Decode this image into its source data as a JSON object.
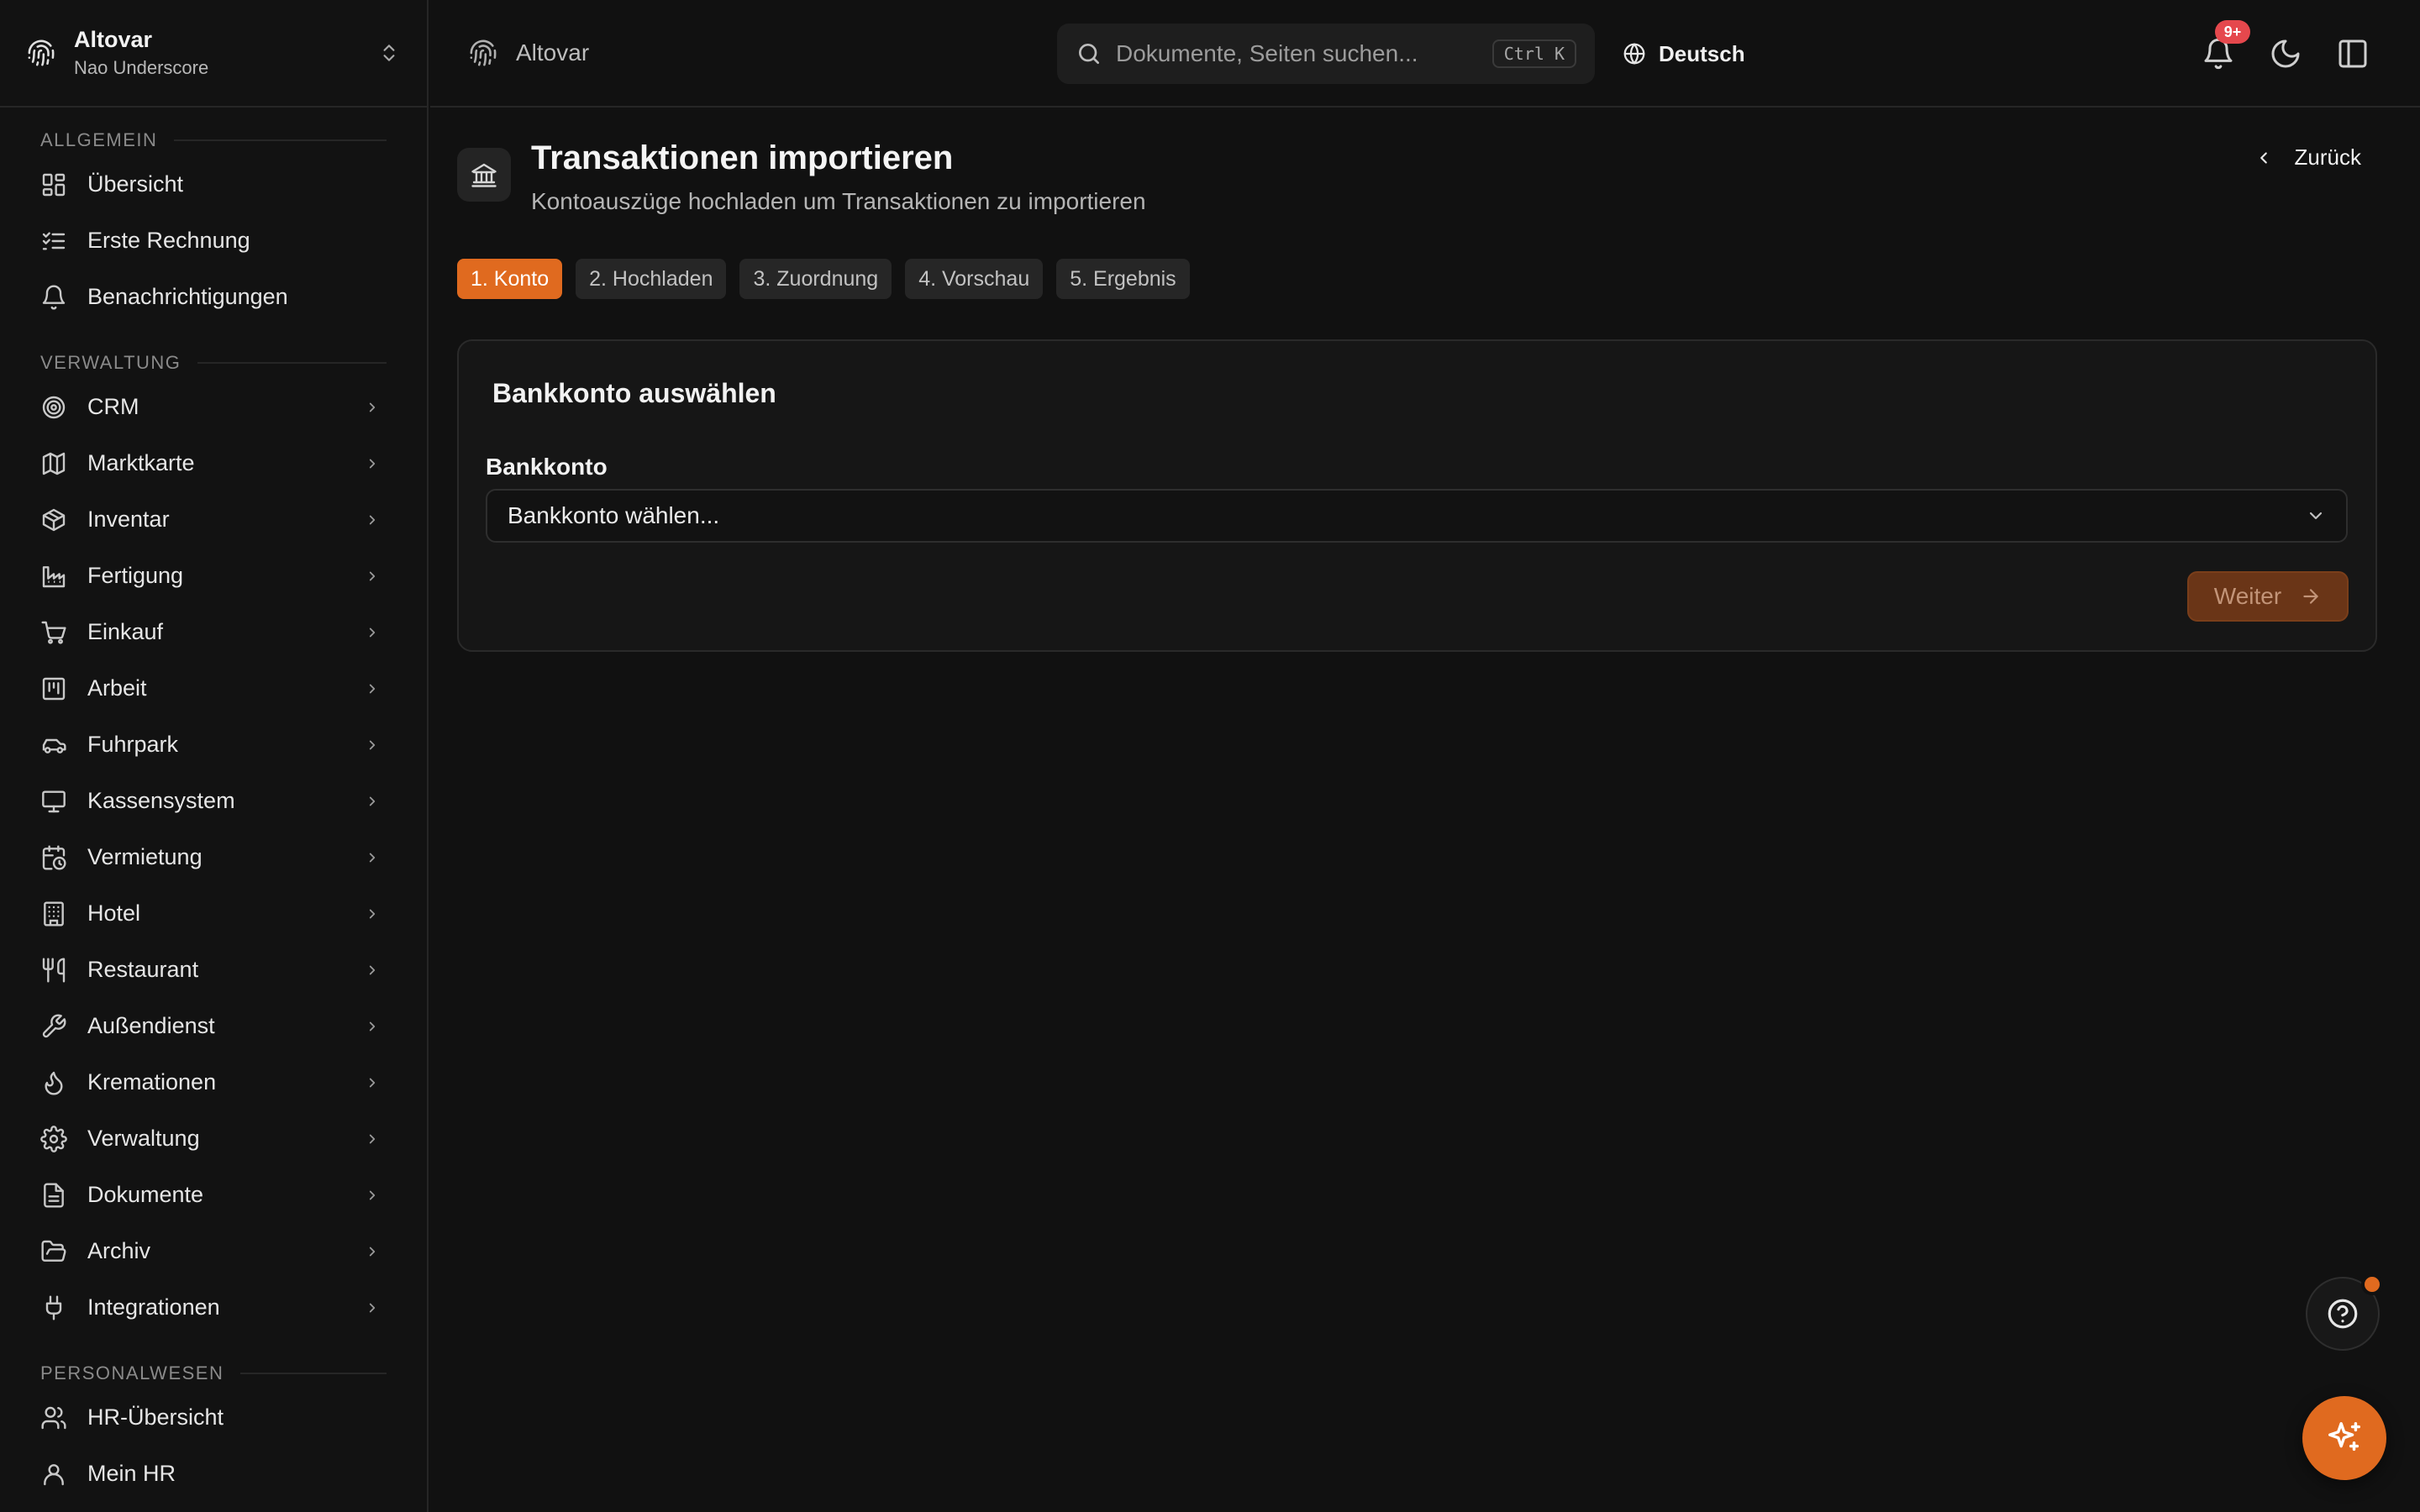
{
  "org": {
    "name": "Altovar",
    "subtitle": "Nao Underscore"
  },
  "sidebar": {
    "sections": [
      {
        "label": "ALLGEMEIN",
        "items": [
          {
            "label": "Übersicht",
            "icon": "dashboard-icon"
          },
          {
            "label": "Erste Rechnung",
            "icon": "checklist-icon"
          },
          {
            "label": "Benachrichtigungen",
            "icon": "bell-icon"
          }
        ]
      },
      {
        "label": "VERWALTUNG",
        "items": [
          {
            "label": "CRM",
            "icon": "target-icon"
          },
          {
            "label": "Marktkarte",
            "icon": "map-icon"
          },
          {
            "label": "Inventar",
            "icon": "package-icon"
          },
          {
            "label": "Fertigung",
            "icon": "factory-icon"
          },
          {
            "label": "Einkauf",
            "icon": "cart-icon"
          },
          {
            "label": "Arbeit",
            "icon": "kanban-icon"
          },
          {
            "label": "Fuhrpark",
            "icon": "car-icon"
          },
          {
            "label": "Kassensystem",
            "icon": "monitor-icon"
          },
          {
            "label": "Vermietung",
            "icon": "calendar-clock-icon"
          },
          {
            "label": "Hotel",
            "icon": "building-icon"
          },
          {
            "label": "Restaurant",
            "icon": "utensils-icon"
          },
          {
            "label": "Außendienst",
            "icon": "wrench-icon"
          },
          {
            "label": "Kremationen",
            "icon": "flame-icon"
          },
          {
            "label": "Verwaltung",
            "icon": "gear-icon"
          },
          {
            "label": "Dokumente",
            "icon": "file-icon"
          },
          {
            "label": "Archiv",
            "icon": "folder-open-icon"
          },
          {
            "label": "Integrationen",
            "icon": "plug-icon"
          }
        ]
      },
      {
        "label": "PERSONALWESEN",
        "items": [
          {
            "label": "HR-Übersicht",
            "icon": "users-icon"
          },
          {
            "label": "Mein HR",
            "icon": "user-icon"
          }
        ]
      }
    ]
  },
  "header": {
    "breadcrumb": "Altovar",
    "search_placeholder": "Dokumente, Seiten suchen...",
    "search_shortcut": "Ctrl K",
    "language": "Deutsch",
    "notification_count": "9+"
  },
  "page": {
    "title": "Transaktionen importieren",
    "subtitle": "Kontoauszüge hochladen um Transaktionen zu importieren",
    "back_label": "Zurück",
    "steps": [
      {
        "label": "1. Konto",
        "active": true
      },
      {
        "label": "2. Hochladen",
        "active": false
      },
      {
        "label": "3. Zuordnung",
        "active": false
      },
      {
        "label": "4. Vorschau",
        "active": false
      },
      {
        "label": "5. Ergebnis",
        "active": false
      }
    ],
    "card_title": "Bankkonto auswählen",
    "field_label": "Bankkonto",
    "select_placeholder": "Bankkonto wählen...",
    "next_label": "Weiter"
  },
  "colors": {
    "accent": "#e06a1f",
    "background": "#111111",
    "badge": "#e5484d"
  }
}
